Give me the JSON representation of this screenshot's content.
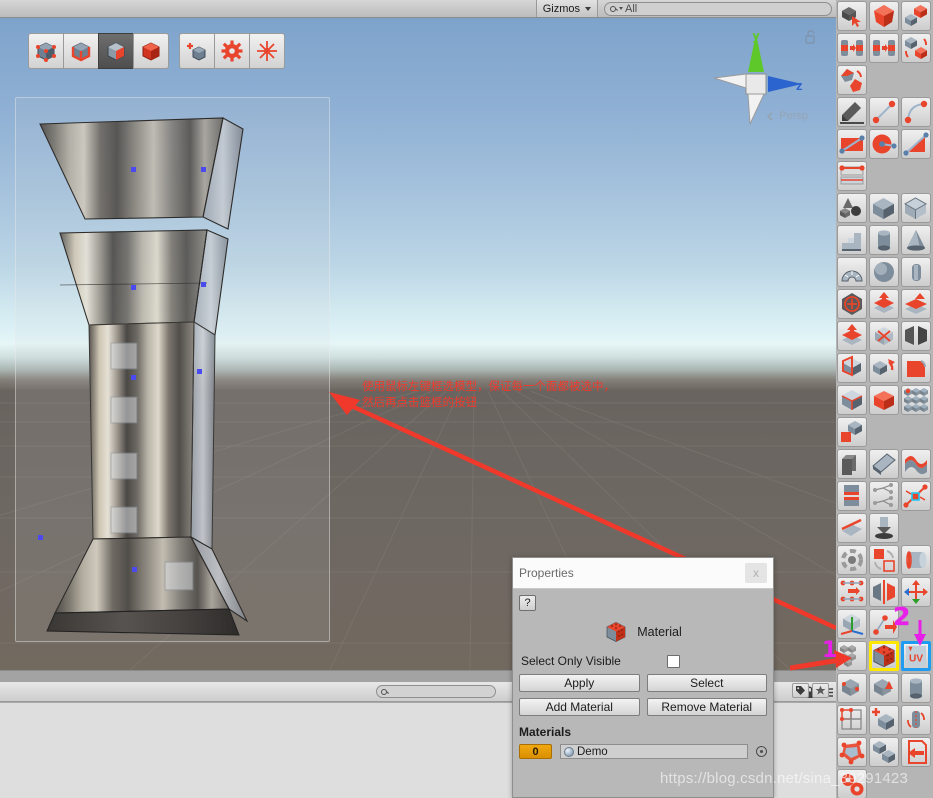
{
  "topbar": {
    "gizmos_label": "Gizmos",
    "search_value": "All",
    "search_icon": "search-icon",
    "caret_icon": "chevron-down-icon"
  },
  "scene": {
    "projection_label": "Persp",
    "axis_y_label": "y",
    "axis_z_label": "z",
    "lock_icon": "lock-open-icon",
    "annotation_line1": "使用鼠标左键框选模型，保证每一个面都被选中，",
    "annotation_line2": "然后再点击篮框的按钮",
    "annotation_color": "#f0392b",
    "sky_top_color": "#7ea3cb",
    "sky_horizon_color": "#e6f6f7",
    "ground_color": "#6b6560"
  },
  "pb_toolbar": {
    "buttons": [
      {
        "name": "select-vertex-button",
        "icon": "cube-vertex-icon",
        "selected": false
      },
      {
        "name": "select-edge-button",
        "icon": "cube-edge-icon",
        "selected": false
      },
      {
        "name": "select-face-button",
        "icon": "cube-face-icon",
        "selected": true
      },
      {
        "name": "select-object-button",
        "icon": "cube-object-icon",
        "selected": false
      },
      {
        "name": "new-shape-button",
        "icon": "cube-plus-icon",
        "selected": false
      },
      {
        "name": "settings-button",
        "icon": "gear-icon",
        "selected": false
      },
      {
        "name": "snap-button",
        "icon": "asterisk-icon",
        "selected": false
      }
    ]
  },
  "properties": {
    "title": "Properties",
    "close_label": "x",
    "help_label": "?",
    "header_label": "Material",
    "header_icon": "material-cube-icon",
    "select_only_visible_label": "Select Only Visible",
    "select_only_visible_checked": false,
    "buttons": [
      {
        "name": "apply-button",
        "label": "Apply"
      },
      {
        "name": "select-button",
        "label": "Select"
      },
      {
        "name": "add-material-button",
        "label": "Add Material"
      },
      {
        "name": "remove-material-button",
        "label": "Remove Material"
      }
    ],
    "materials_heading": "Materials",
    "material_slots": [
      {
        "index": "0",
        "name": "Demo",
        "icon": "sphere-icon",
        "picker_icon": "object-picker-icon"
      }
    ]
  },
  "bottom_bar": {
    "search_placeholder": "",
    "icons": [
      {
        "name": "lock-icon"
      },
      {
        "name": "menu-icon"
      },
      {
        "name": "tag-icon"
      },
      {
        "name": "star-icon"
      }
    ]
  },
  "sidebar": {
    "callout_1": "1",
    "callout_2": "2",
    "highlight_yellow": "#ffe800",
    "highlight_blue": "#1f9cf0",
    "callout_color": "#e81fe8",
    "tools": [
      {
        "name": "tool-select-object",
        "icon": "cursor-cube-icon",
        "col": 0,
        "row": 0
      },
      {
        "name": "tool-smooth-shape",
        "icon": "red-polyhedron-icon",
        "col": 1,
        "row": 0
      },
      {
        "name": "tool-combine-objects",
        "icon": "cubes-merge-icon",
        "col": 2,
        "row": 0
      },
      {
        "name": "tool-merge-to-left",
        "icon": "pillars-merge-left-icon",
        "col": 0,
        "row": 1
      },
      {
        "name": "tool-merge-to-one",
        "icon": "pillars-merge-one-icon",
        "col": 1,
        "row": 1
      },
      {
        "name": "tool-mirror-objects",
        "icon": "cubes-mirror-icon",
        "col": 2,
        "row": 1
      },
      {
        "name": "tool-flip-normals",
        "icon": "polyhedron-flip-icon",
        "col": 0,
        "row": 2
      },
      {
        "name": "tool-poly-shape",
        "icon": "pen-nib-icon",
        "col": 0,
        "row": 3
      },
      {
        "name": "tool-bezier-line",
        "icon": "line-two-points-icon",
        "col": 1,
        "row": 3
      },
      {
        "name": "tool-bezier-curve",
        "icon": "curve-two-points-icon",
        "col": 2,
        "row": 3
      },
      {
        "name": "tool-fill-hole",
        "icon": "plane-fill-icon",
        "col": 0,
        "row": 4
      },
      {
        "name": "tool-radial-cut",
        "icon": "pie-cut-icon",
        "col": 1,
        "row": 4
      },
      {
        "name": "tool-triangle-cut",
        "icon": "triangle-cut-icon",
        "col": 2,
        "row": 4
      },
      {
        "name": "tool-edge-band",
        "icon": "edge-band-icon",
        "col": 0,
        "row": 5
      },
      {
        "name": "tool-primitives",
        "icon": "primitives-icon",
        "col": 0,
        "row": 6
      },
      {
        "name": "tool-cube",
        "icon": "cube-blue-icon",
        "col": 1,
        "row": 6
      },
      {
        "name": "tool-cube-wire",
        "icon": "cube-wire-icon",
        "col": 2,
        "row": 6
      },
      {
        "name": "tool-stairs",
        "icon": "stairs-icon",
        "col": 0,
        "row": 7
      },
      {
        "name": "tool-cylinder",
        "icon": "cylinder-icon",
        "col": 1,
        "row": 7
      },
      {
        "name": "tool-cone",
        "icon": "cone-icon",
        "col": 2,
        "row": 7
      },
      {
        "name": "tool-arch",
        "icon": "arch-icon",
        "col": 0,
        "row": 8
      },
      {
        "name": "tool-sphere",
        "icon": "sphere-icon",
        "col": 1,
        "row": 8
      },
      {
        "name": "tool-pipe",
        "icon": "pipe-icon",
        "col": 2,
        "row": 8
      },
      {
        "name": "tool-center-pivot",
        "icon": "pivot-center-icon",
        "col": 0,
        "row": 9
      },
      {
        "name": "tool-extrude-face",
        "icon": "extrude-up-icon",
        "col": 1,
        "row": 9
      },
      {
        "name": "tool-extrude-faces",
        "icon": "extrude-up-multi-icon",
        "col": 2,
        "row": 9
      },
      {
        "name": "tool-extrude-single",
        "icon": "extrude-single-icon",
        "col": 0,
        "row": 10
      },
      {
        "name": "tool-flip-face",
        "icon": "flip-face-icon",
        "col": 1,
        "row": 10
      },
      {
        "name": "tool-split-object",
        "icon": "split-object-icon",
        "col": 2,
        "row": 10
      },
      {
        "name": "tool-bridge-edges",
        "icon": "bridge-edges-icon",
        "col": 0,
        "row": 11
      },
      {
        "name": "tool-detach-face",
        "icon": "detach-face-icon",
        "col": 1,
        "row": 11
      },
      {
        "name": "tool-bevel",
        "icon": "bevel-icon",
        "col": 2,
        "row": 11
      },
      {
        "name": "tool-subdivide-face",
        "icon": "subdivide-face-icon",
        "col": 0,
        "row": 12
      },
      {
        "name": "tool-open-box",
        "icon": "open-box-icon",
        "col": 1,
        "row": 12
      },
      {
        "name": "tool-grid-faces",
        "icon": "grid-faces-icon",
        "col": 2,
        "row": 12
      },
      {
        "name": "tool-flip-tri",
        "icon": "flip-triangle-icon",
        "col": 0,
        "row": 13
      },
      {
        "name": "tool-delete-edge",
        "icon": "eraser-icon",
        "col": 0,
        "row": 14
      },
      {
        "name": "tool-insert-edge",
        "icon": "insert-edge-icon",
        "col": 1,
        "row": 14
      },
      {
        "name": "tool-bridge",
        "icon": "bridge-icon",
        "col": 2,
        "row": 14
      },
      {
        "name": "tool-connect-edges",
        "icon": "connect-edges-icon",
        "col": 0,
        "row": 15
      },
      {
        "name": "tool-split-vertices",
        "icon": "split-vertices-icon",
        "col": 1,
        "row": 15
      },
      {
        "name": "tool-collapse-verts",
        "icon": "collapse-vertices-icon",
        "col": 2,
        "row": 15
      },
      {
        "name": "tool-weld-verts",
        "icon": "weld-vertices-icon",
        "col": 0,
        "row": 16
      },
      {
        "name": "tool-push-vertex",
        "icon": "push-vertex-icon",
        "col": 1,
        "row": 16
      },
      {
        "name": "tool-smooth-group",
        "icon": "smoothing-icon",
        "col": 0,
        "row": 17
      },
      {
        "name": "tool-swap-material",
        "icon": "swap-material-icon",
        "col": 1,
        "row": 17
      },
      {
        "name": "tool-uv-cylinder",
        "icon": "uv-cylinder-icon",
        "col": 2,
        "row": 17
      },
      {
        "name": "tool-set-vertex-color",
        "icon": "vertex-color-icon",
        "col": 0,
        "row": 18
      },
      {
        "name": "tool-mirror-geometry",
        "icon": "mirror-geometry-icon",
        "col": 1,
        "row": 18
      },
      {
        "name": "tool-move-pivot",
        "icon": "move-pivot-icon",
        "col": 2,
        "row": 18
      },
      {
        "name": "tool-pivot-to-origin",
        "icon": "pivot-origin-icon",
        "col": 0,
        "row": 19
      },
      {
        "name": "tool-conform-normals",
        "icon": "conform-normals-icon",
        "col": 1,
        "row": 19
      },
      {
        "name": "tool-material-editor",
        "icon": "material-cube-icon",
        "col": 1,
        "row": 20,
        "highlight": "yellow"
      },
      {
        "name": "tool-uv-editor",
        "icon": "uv-editor-icon",
        "col": 2,
        "row": 20,
        "highlight": "blue"
      },
      {
        "name": "tool-vertex-colors",
        "icon": "vertex-colors-grid-icon",
        "col": 0,
        "row": 20
      },
      {
        "name": "tool-subdivide-obj",
        "icon": "subdivide-object-icon",
        "col": 0,
        "row": 21
      },
      {
        "name": "tool-triangulate",
        "icon": "triangulate-icon",
        "col": 1,
        "row": 21
      },
      {
        "name": "tool-cylinder-col",
        "icon": "cylinder-plain-icon",
        "col": 2,
        "row": 21
      },
      {
        "name": "tool-grid-snap",
        "icon": "grid-snap-icon",
        "col": 0,
        "row": 22
      },
      {
        "name": "tool-new-poly",
        "icon": "new-poly-icon",
        "col": 1,
        "row": 22
      },
      {
        "name": "tool-rotate-uv",
        "icon": "rotate-uv-icon",
        "col": 2,
        "row": 22
      },
      {
        "name": "tool-poly-edit",
        "icon": "poly-edit-icon",
        "col": 0,
        "row": 23
      },
      {
        "name": "tool-cubes-pair",
        "icon": "cubes-pair-icon",
        "col": 1,
        "row": 23
      },
      {
        "name": "tool-export",
        "icon": "export-icon",
        "col": 2,
        "row": 23
      },
      {
        "name": "tool-gears",
        "icon": "gears-icon",
        "col": 0,
        "row": 24
      }
    ]
  },
  "watermark": {
    "text": "https://blog.csdn.net/sina_39291423"
  }
}
